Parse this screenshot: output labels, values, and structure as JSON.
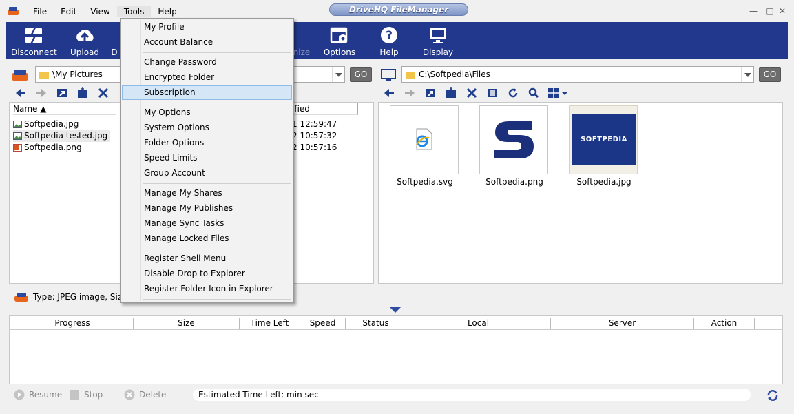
{
  "window": {
    "title": "DriveHQ FileManager",
    "menus": [
      "File",
      "Edit",
      "View",
      "Tools",
      "Help"
    ],
    "controls": {
      "minimize": "—",
      "maximize": "□",
      "close": "✕"
    }
  },
  "toolbar": {
    "disconnect": "Disconnect",
    "upload": "Upload",
    "download_partial": "D",
    "synchronize_partial": "nize",
    "options": "Options",
    "help": "Help",
    "display": "Display"
  },
  "left": {
    "path": "\\My Pictures",
    "go": "GO",
    "columns": {
      "name": "Name ▲",
      "modified": "ified"
    },
    "files": [
      {
        "name": "Softpedia.jpg",
        "modified": "1 12:59:47"
      },
      {
        "name": "Softpedia tested.jpg",
        "modified": "2 10:57:32"
      },
      {
        "name": "Softpedia.png",
        "modified": "2 10:57:16"
      }
    ]
  },
  "right": {
    "path": "C:\\Softpedia\\Files",
    "go": "GO",
    "files": [
      {
        "name": "Softpedia.svg"
      },
      {
        "name": "Softpedia.png"
      },
      {
        "name": "Softpedia.jpg"
      }
    ],
    "thumb_text": "SOFTPEDIA"
  },
  "info": {
    "type_text": "Type: JPEG image, Size"
  },
  "transfer": {
    "columns": [
      "Progress",
      "Size",
      "Time Left",
      "Speed",
      "Status",
      "Local",
      "Server",
      "Action"
    ]
  },
  "bottom": {
    "resume": "Resume",
    "stop": "Stop",
    "delete": "Delete",
    "eta": "Estimated Time Left: min sec"
  },
  "tools_menu": {
    "groups": [
      [
        "My Profile",
        "Account Balance"
      ],
      [
        "Change Password",
        "Encrypted Folder",
        "Subscription"
      ],
      [
        "My Options",
        "System Options",
        "Folder Options",
        "Speed Limits",
        "Group Account"
      ],
      [
        "Manage My Shares",
        "Manage My Publishes",
        "Manage Sync Tasks",
        "Manage Locked Files"
      ],
      [
        "Register Shell Menu",
        "Disable Drop to Explorer",
        "Register Folder Icon in Explorer"
      ]
    ],
    "highlighted": "Subscription"
  },
  "colors": {
    "toolbar_bg": "#22388c",
    "accent": "#2c4aa0",
    "highlight": "#d5e6f7"
  }
}
